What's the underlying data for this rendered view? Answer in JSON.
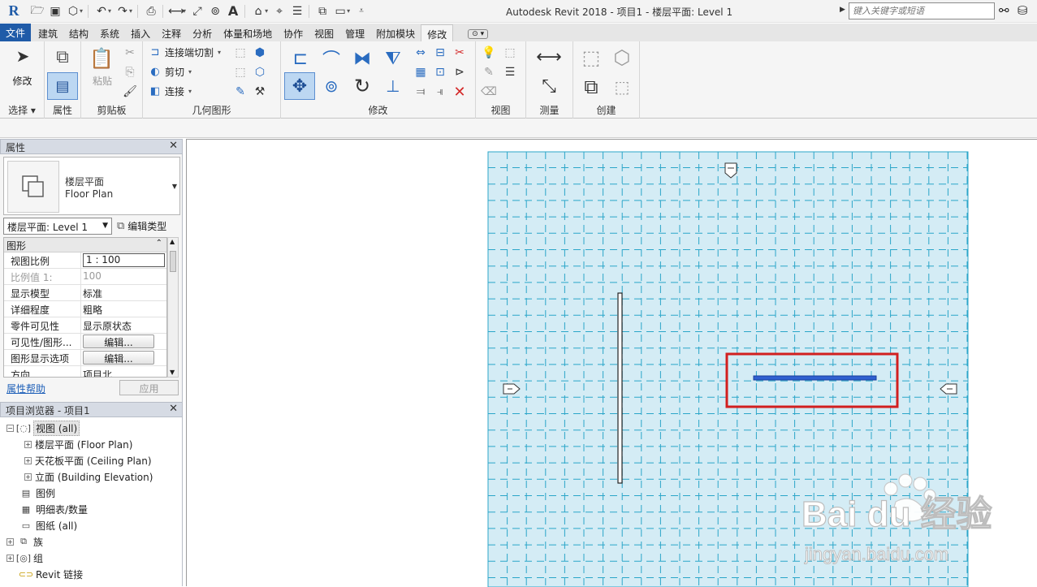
{
  "titlebar": {
    "title": "Autodesk Revit 2018 -    项目1 - 楼层平面: Level 1",
    "search_placeholder": "键入关键字或短语",
    "app_logo": "R"
  },
  "ribbon_tabs": [
    "文件",
    "建筑",
    "结构",
    "系统",
    "插入",
    "注释",
    "分析",
    "体量和场地",
    "协作",
    "视图",
    "管理",
    "附加模块",
    "修改"
  ],
  "ribbon_active_tab": "修改",
  "ribbon": {
    "select": {
      "modify_label": "修改",
      "panel_label": "选择 ▾"
    },
    "properties": {
      "panel_label": "属性"
    },
    "clipboard": {
      "paste_label": "粘贴",
      "panel_label": "剪贴板"
    },
    "geometry": {
      "join_cut_label": "连接端切割",
      "cut_label": "剪切",
      "join_label": "连接",
      "panel_label": "几何图形"
    },
    "modify": {
      "panel_label": "修改"
    },
    "view": {
      "panel_label": "视图"
    },
    "measure": {
      "panel_label": "测量"
    },
    "create": {
      "panel_label": "创建"
    }
  },
  "properties": {
    "header": "属性",
    "type_name_cn": "楼层平面",
    "type_name_en": "Floor Plan",
    "instance_selector": "楼层平面: Level 1",
    "edit_type_label": "编辑类型",
    "group_label": "图形",
    "rows": [
      {
        "key": "视图比例",
        "value": "1 : 100",
        "kind": "input"
      },
      {
        "key": "比例值 1:",
        "value": "100",
        "kind": "dim"
      },
      {
        "key": "显示模型",
        "value": "标准",
        "kind": "text"
      },
      {
        "key": "详细程度",
        "value": "粗略",
        "kind": "text"
      },
      {
        "key": "零件可见性",
        "value": "显示原状态",
        "kind": "text"
      },
      {
        "key": "可见性/图形...",
        "value": "编辑...",
        "kind": "button"
      },
      {
        "key": "图形显示选项",
        "value": "编辑...",
        "kind": "button"
      },
      {
        "key": "方向",
        "value": "项目北",
        "kind": "text"
      }
    ],
    "help_link": "属性帮助",
    "apply_label": "应用"
  },
  "browser": {
    "header": "项目浏览器 - 项目1",
    "items": [
      {
        "label": "视图 (all)",
        "level": 0,
        "toggle": "−",
        "icon": "views-icon",
        "selected": true
      },
      {
        "label": "楼层平面 (Floor Plan)",
        "level": 1,
        "toggle": "+",
        "icon": "",
        "selected": false
      },
      {
        "label": "天花板平面 (Ceiling Plan)",
        "level": 1,
        "toggle": "+",
        "icon": "",
        "selected": false
      },
      {
        "label": "立面 (Building Elevation)",
        "level": 1,
        "toggle": "+",
        "icon": "",
        "selected": false
      },
      {
        "label": "图例",
        "level": 0,
        "toggle": "",
        "icon": "legend-icon",
        "selected": false
      },
      {
        "label": "明细表/数量",
        "level": 0,
        "toggle": "",
        "icon": "schedule-icon",
        "selected": false
      },
      {
        "label": "图纸 (all)",
        "level": 0,
        "toggle": "",
        "icon": "sheet-icon",
        "selected": false
      },
      {
        "label": "族",
        "level": 0,
        "toggle": "+",
        "icon": "family-icon",
        "selected": false
      },
      {
        "label": "组",
        "level": 0,
        "toggle": "+",
        "icon": "group-icon",
        "selected": false
      },
      {
        "label": "Revit 链接",
        "level": 0,
        "toggle": "",
        "icon": "link-icon",
        "selected": false
      }
    ]
  },
  "colors": {
    "file_tab": "#1f5ba8",
    "grid_bg": "#d4ecf5",
    "grid_line": "#2ba6c9",
    "selected_line": "#2f5fd0",
    "highlight_box": "#d21f1f"
  },
  "watermark": {
    "brand": "Bai du 经验",
    "url": "jingyan.baidu.com"
  }
}
